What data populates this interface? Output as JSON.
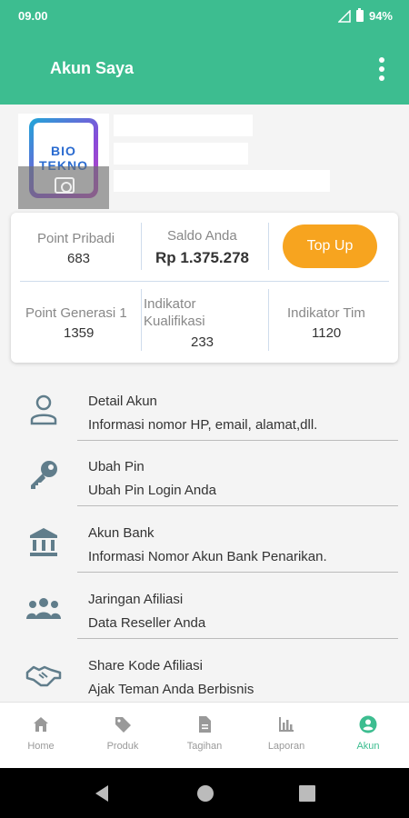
{
  "status": {
    "time": "09.00",
    "battery": "94%"
  },
  "appbar": {
    "title": "Akun Saya"
  },
  "logo": {
    "line1": "BIO",
    "line2": "TEKNO"
  },
  "stats": {
    "point_pribadi_label": "Point Pribadi",
    "point_pribadi_value": "683",
    "saldo_label": "Saldo Anda",
    "saldo_value": "Rp 1.375.278",
    "topup_label": "Top Up",
    "point_generasi_label": "Point Generasi 1",
    "point_generasi_value": "1359",
    "indikator_kualifikasi_label_1": "Indikator",
    "indikator_kualifikasi_label_2": "Kualifikasi",
    "indikator_kualifikasi_value": "233",
    "indikator_tim_label": "Indikator Tim",
    "indikator_tim_value": "1120"
  },
  "menu": [
    {
      "title": "Detail Akun",
      "subtitle": "Informasi nomor HP, email, alamat,dll.",
      "icon": "user-icon"
    },
    {
      "title": "Ubah Pin",
      "subtitle": "Ubah Pin Login Anda",
      "icon": "key-icon"
    },
    {
      "title": "Akun Bank",
      "subtitle": "Informasi Nomor Akun Bank Penarikan.",
      "icon": "bank-icon"
    },
    {
      "title": "Jaringan Afiliasi",
      "subtitle": "Data Reseller Anda",
      "icon": "group-icon"
    },
    {
      "title": "Share Kode Afiliasi",
      "subtitle": "Ajak Teman Anda Berbisnis",
      "icon": "handshake-icon"
    }
  ],
  "bottom_nav": [
    {
      "label": "Home",
      "icon": "home-icon",
      "active": false
    },
    {
      "label": "Produk",
      "icon": "tag-icon",
      "active": false
    },
    {
      "label": "Tagihan",
      "icon": "document-icon",
      "active": false
    },
    {
      "label": "Laporan",
      "icon": "bar-chart-icon",
      "active": false
    },
    {
      "label": "Akun",
      "icon": "account-circle-icon",
      "active": true
    }
  ],
  "colors": {
    "primary": "#3dbd90",
    "accent": "#f7a41f",
    "icon": "#607d8b"
  }
}
